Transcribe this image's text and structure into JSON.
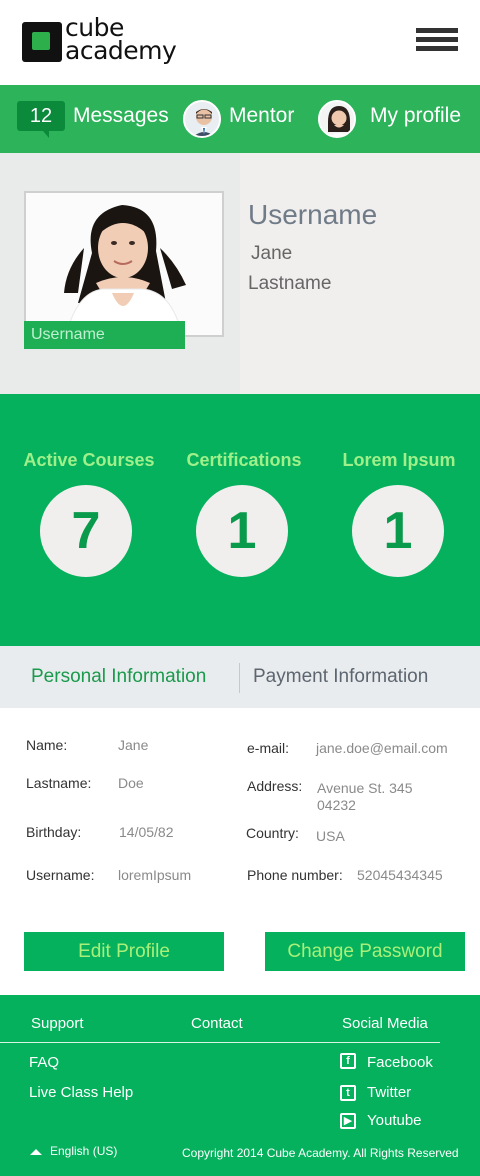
{
  "brand": {
    "line1": "cube",
    "line2": "academy",
    "accent_color": "#05b15c"
  },
  "nav": {
    "messages_count": "12",
    "messages_label": "Messages",
    "mentor_label": "Mentor",
    "profile_label": "My profile"
  },
  "profile": {
    "photo_caption": "Username",
    "username": "Username",
    "first_name": "Jane",
    "last_name": "Lastname"
  },
  "stats": [
    {
      "label": "Active Courses",
      "value": "7"
    },
    {
      "label": "Certifications",
      "value": "1"
    },
    {
      "label": "Lorem Ipsum",
      "value": "1"
    }
  ],
  "tabs": {
    "personal": "Personal Information",
    "payment": "Payment Information"
  },
  "info": {
    "name_label": "Name:",
    "name_value": "Jane",
    "lastname_label": "Lastname:",
    "lastname_value": "Doe",
    "birthday_label": "Birthday:",
    "birthday_value": "14/05/82",
    "username_label": "Username:",
    "username_value": "loremIpsum",
    "email_label": "e-mail:",
    "email_value": "jane.doe@email.com",
    "address_label": "Address:",
    "address_line1": "Avenue St. 345",
    "address_line2": "04232",
    "country_label": "Country:",
    "country_value": "USA",
    "phone_label": "Phone number:",
    "phone_value": "52045434345"
  },
  "buttons": {
    "edit_profile": "Edit Profile",
    "change_password": "Change Password"
  },
  "footer": {
    "support": "Support",
    "contact": "Contact",
    "social": "Social Media",
    "faq": "FAQ",
    "live_class_help": "Live Class Help",
    "facebook": "Facebook",
    "twitter": "Twitter",
    "youtube": "Youtube",
    "language": "English (US)",
    "copyright": "Copyright 2014 Cube Academy. All Rights Reserved"
  },
  "icons": [
    "hamburger-menu-icon",
    "facebook-icon",
    "twitter-icon",
    "youtube-icon",
    "caret-up-icon"
  ]
}
